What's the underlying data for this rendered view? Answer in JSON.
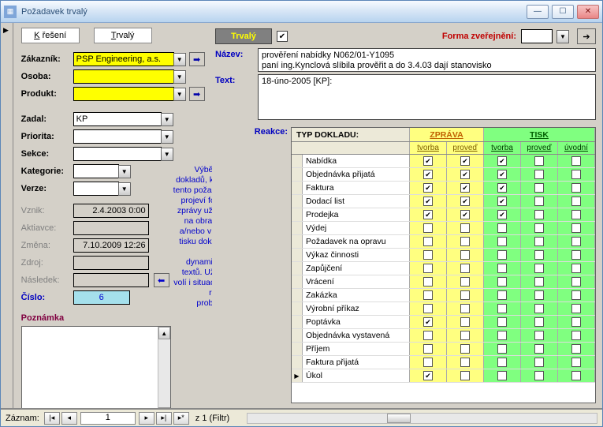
{
  "window": {
    "title": "Požadavek trvalý"
  },
  "tabs": {
    "kreseni": "K řešení",
    "trvaly": "Trvalý"
  },
  "left": {
    "zakaznik_label": "Zákazník:",
    "zakaznik_value": "PSP Engineering, a.s.",
    "osoba_label": "Osoba:",
    "produkt_label": "Produkt:",
    "zadal_label": "Zadal:",
    "zadal_value": "KP",
    "priorita_label": "Priorita:",
    "sekce_label": "Sekce:",
    "kategorie_label": "Kategorie:",
    "verze_label": "Verze:",
    "vznik_label": "Vznik:",
    "vznik_value": "2.4.2003 0:00",
    "aktivace_label": "Aktiavce:",
    "zmena_label": "Změna:",
    "zmena_value": "7.10.2009 12:26",
    "zdroj_label": "Zdroj:",
    "nasledek_label": "Následek:",
    "cislo_label": "Číslo:",
    "cislo_value": "6",
    "poznamka_label": "Poznámka"
  },
  "right": {
    "trvaly_badge": "Trvalý",
    "forma_label": "Forma zveřejnění:",
    "nazev_label": "Název:",
    "nazev_value": "prověření nabídky N062/01-Y1095\npaní ing.Kynclová slíbila prověřit a do 3.4.03 dají stanovisko",
    "text_label": "Text:",
    "text_value": "18-úno-2005 [KP]:"
  },
  "reakce": {
    "label": "Reakce:",
    "help": "Výběr typu dokladů, kde se tento požadavek projeví formou zprávy uživateli na obrazovce a/nebo v rámci tisku dokladu v sekci dynamických textů. Uživatel volí i situaci, kdy reakce proběhne."
  },
  "grid": {
    "hdr_typ": "TYP DOKLADU:",
    "hdr_zprava": "ZPRÁVA",
    "hdr_tisk": "TISK",
    "sub_tvorba": "tvorba",
    "sub_proved": "proveď",
    "sub_uvodni": "úvodní",
    "rows": [
      {
        "name": "Nabídka",
        "z1": true,
        "z2": true,
        "t1": true,
        "t2": false,
        "t3": false
      },
      {
        "name": "Objednávka přijatá",
        "z1": true,
        "z2": true,
        "t1": true,
        "t2": false,
        "t3": false
      },
      {
        "name": "Faktura",
        "z1": true,
        "z2": true,
        "t1": true,
        "t2": false,
        "t3": false
      },
      {
        "name": "Dodací list",
        "z1": true,
        "z2": true,
        "t1": true,
        "t2": false,
        "t3": false
      },
      {
        "name": "Prodejka",
        "z1": true,
        "z2": true,
        "t1": true,
        "t2": false,
        "t3": false
      },
      {
        "name": "Výdej",
        "z1": false,
        "z2": false,
        "t1": false,
        "t2": false,
        "t3": false
      },
      {
        "name": "Požadavek na opravu",
        "z1": false,
        "z2": false,
        "t1": false,
        "t2": false,
        "t3": false
      },
      {
        "name": "Výkaz činnosti",
        "z1": false,
        "z2": false,
        "t1": false,
        "t2": false,
        "t3": false
      },
      {
        "name": "Zapůjčení",
        "z1": false,
        "z2": false,
        "t1": false,
        "t2": false,
        "t3": false
      },
      {
        "name": "Vrácení",
        "z1": false,
        "z2": false,
        "t1": false,
        "t2": false,
        "t3": false
      },
      {
        "name": "Zakázka",
        "z1": false,
        "z2": false,
        "t1": false,
        "t2": false,
        "t3": false
      },
      {
        "name": "Výrobní příkaz",
        "z1": false,
        "z2": false,
        "t1": false,
        "t2": false,
        "t3": false
      },
      {
        "name": "Poptávka",
        "z1": true,
        "z2": false,
        "t1": false,
        "t2": false,
        "t3": false
      },
      {
        "name": "Objednávka vystavená",
        "z1": false,
        "z2": false,
        "t1": false,
        "t2": false,
        "t3": false
      },
      {
        "name": "Příjem",
        "z1": false,
        "z2": false,
        "t1": false,
        "t2": false,
        "t3": false
      },
      {
        "name": "Faktura přijatá",
        "z1": false,
        "z2": false,
        "t1": false,
        "t2": false,
        "t3": false
      },
      {
        "name": "Úkol",
        "z1": true,
        "z2": false,
        "t1": false,
        "t2": false,
        "t3": false,
        "sel": true
      }
    ]
  },
  "record": {
    "label": "Záznam:",
    "num": "1",
    "of": "z  1 (Filtr)"
  }
}
